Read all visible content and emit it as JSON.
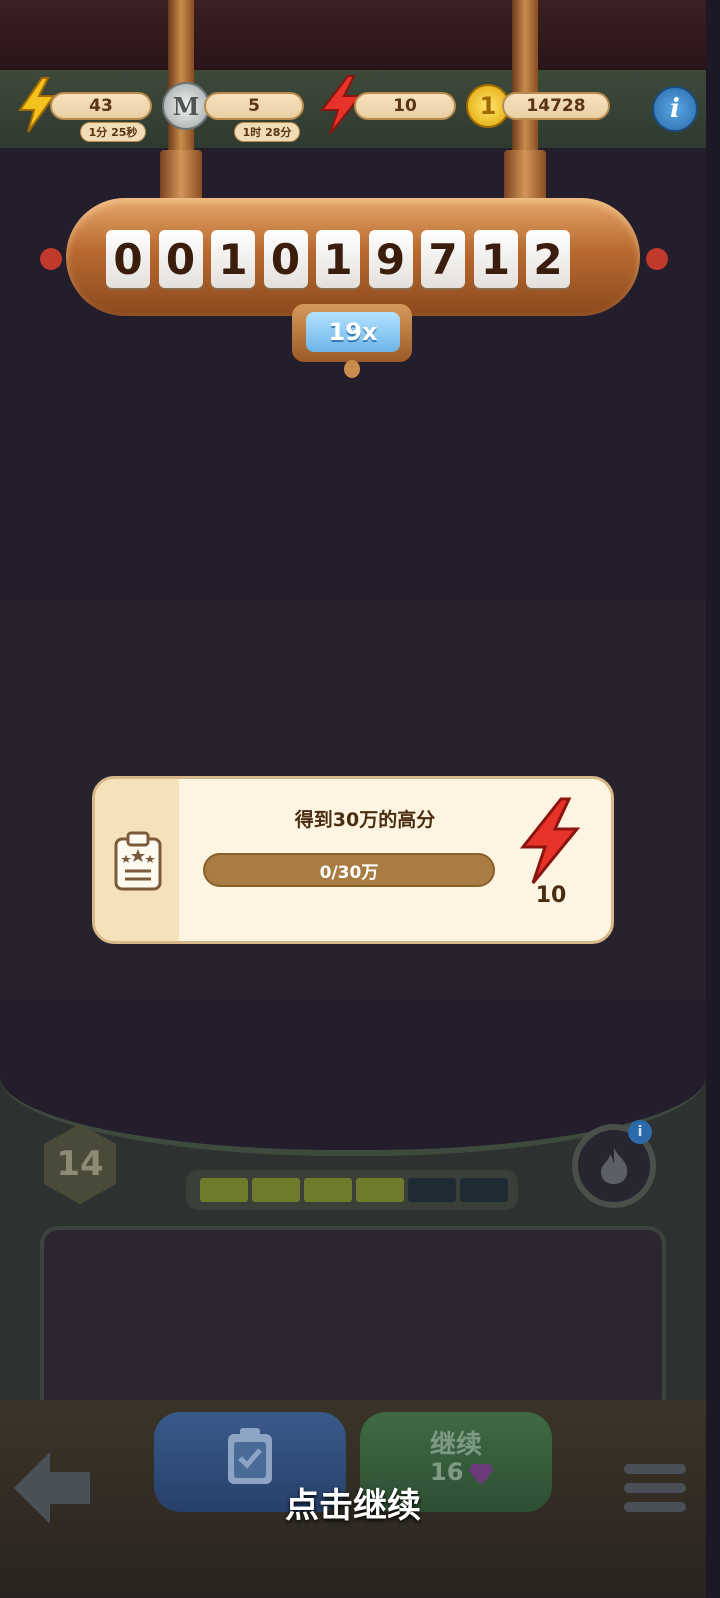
{
  "hud": {
    "energy": {
      "value": "43",
      "timer": "1分 25秒",
      "icon": "lightning-yellow-icon"
    },
    "medal": {
      "value": "5",
      "timer": "1时 28分",
      "icon": "m-coin-icon",
      "letter": "M"
    },
    "boost": {
      "value": "10",
      "icon": "lightning-red-icon"
    },
    "coins": {
      "value": "14728",
      "icon": "gold-coin-icon",
      "coin_label": "1"
    },
    "info_label": "i"
  },
  "score": {
    "digits": [
      "0",
      "0",
      "1",
      "0",
      "1",
      "9",
      "7",
      "1",
      "2"
    ],
    "multiplier": "19x"
  },
  "mission": {
    "title": "得到30万的高分",
    "progress_text": "0/30万",
    "progress_fraction": 0,
    "reward": "10",
    "icon": "clipboard-stars-icon",
    "reward_icon": "lightning-red-icon"
  },
  "level": {
    "number": "14",
    "bar_segments": [
      true,
      true,
      true,
      true,
      false,
      false
    ],
    "fire_info_label": "i"
  },
  "buttons": {
    "continue_label": "继续",
    "continue_cost": "16",
    "tap_to_continue": "点击继续"
  },
  "colors": {
    "accent_copper": "#c98c4d",
    "bar_filled": "#6f7a2a",
    "bar_empty": "#1e2a34"
  }
}
